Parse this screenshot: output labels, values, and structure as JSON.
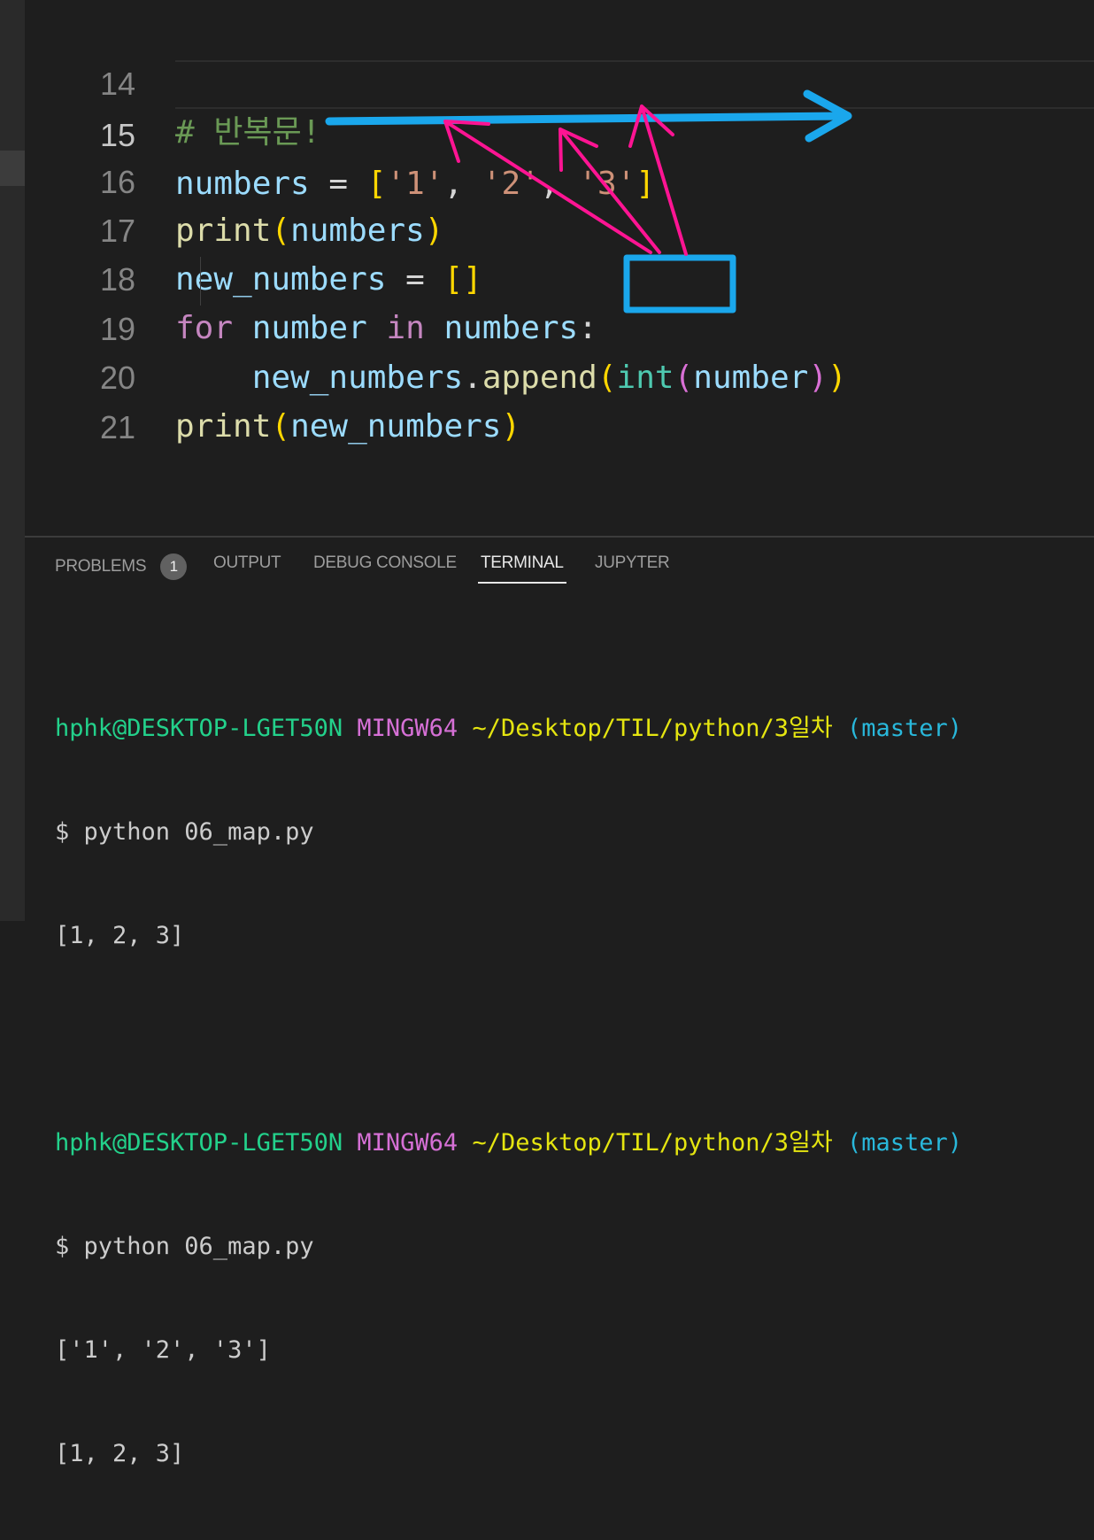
{
  "editor": {
    "lines": [
      {
        "num": "14",
        "comment": "# 반복문!"
      },
      {
        "num": "15",
        "var1": "numbers",
        "eq": "=",
        "lb": "[",
        "s1": "'1'",
        "comma1": ",",
        "s2": "'2'",
        "comma2": ",",
        "s3": "'3'",
        "rb": "]"
      },
      {
        "num": "16",
        "func": "print",
        "lp": "(",
        "arg": "numbers",
        "rp": ")"
      },
      {
        "num": "17",
        "var1": "new_numbers",
        "eq": "=",
        "brackets": "[]"
      },
      {
        "num": "18",
        "kw1": "for",
        "var1": "number",
        "kw2": "in",
        "var2": "numbers",
        "colon": ":"
      },
      {
        "num": "19",
        "obj": "new_numbers",
        "dot": ".",
        "method": "append",
        "lp": "(",
        "builtin": "int",
        "lp2": "(",
        "arg": "number",
        "rp2": ")",
        "rp": ")"
      },
      {
        "num": "20",
        "func": "print",
        "lp": "(",
        "arg": "new_numbers",
        "rp": ")"
      },
      {
        "num": "21"
      }
    ]
  },
  "panel": {
    "tabs": {
      "problems": "PROBLEMS",
      "problems_count": "1",
      "output": "OUTPUT",
      "debug_console": "DEBUG CONSOLE",
      "terminal": "TERMINAL",
      "jupyter": "JUPYTER"
    },
    "active_tab": "TERMINAL"
  },
  "terminal": {
    "sessions": [
      {
        "user": "hphk@DESKTOP-LGET50N",
        "system": "MINGW64",
        "path": "~/Desktop/TIL/python/3일차",
        "branch": "(master)",
        "command": "$ python 06_map.py",
        "output": [
          "[1, 2, 3]"
        ]
      },
      {
        "user": "hphk@DESKTOP-LGET50N",
        "system": "MINGW64",
        "path": "~/Desktop/TIL/python/3일차",
        "branch": "(master)",
        "command": "$ python 06_map.py",
        "output": [
          "['1', '2', '3']",
          "[1, 2, 3]"
        ]
      }
    ]
  },
  "colors": {
    "annotation_blue": "#1aa7ec",
    "annotation_pink": "#ff1493"
  },
  "icons": [
    "arrow-annotation-icon"
  ]
}
